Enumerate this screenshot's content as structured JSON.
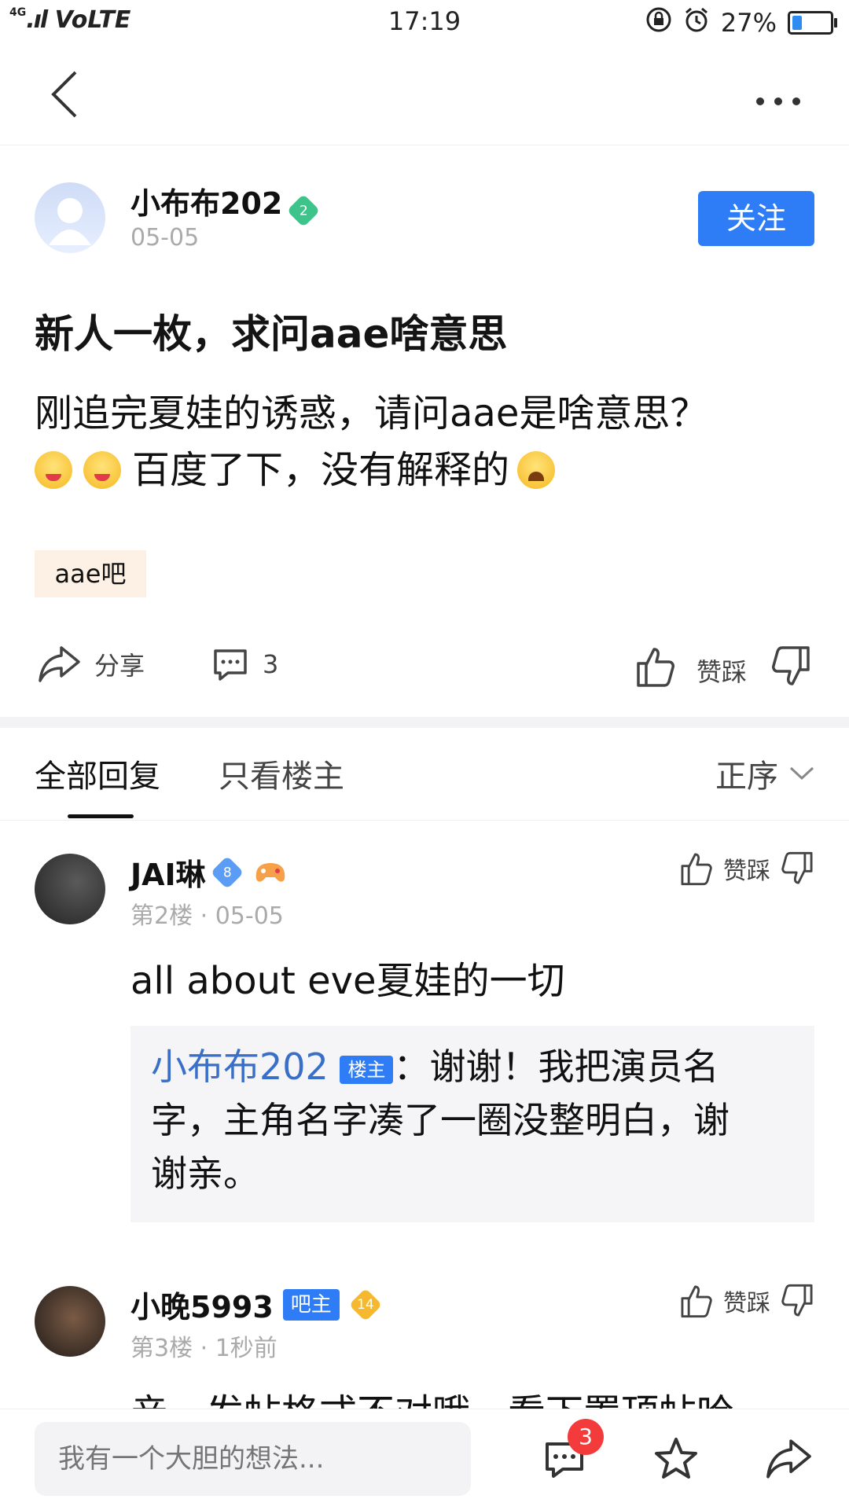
{
  "status_bar": {
    "signal": "4G",
    "network": "VoLTE",
    "time": "17:19",
    "battery": "27%",
    "battery_level": 0.27
  },
  "post": {
    "author": "小布布202",
    "author_level": "2",
    "date": "05-05",
    "follow_label": "关注",
    "title": "新人一枚，求问aae啥意思",
    "content_line1": "刚追完夏娃的诱惑，请问aae是啥意思？",
    "content_line2": "百度了下，没有解释的",
    "tag": "aae吧",
    "share_label": "分享",
    "comment_count": "3",
    "vote_label": "赞踩"
  },
  "tabs": {
    "all": "全部回复",
    "op_only": "只看楼主",
    "sort": "正序"
  },
  "replies": [
    {
      "name": "JAI琳",
      "level": "8",
      "floor": "第2楼",
      "date": "05-05",
      "text": "all about eve夏娃的一切",
      "vote_label": "赞踩",
      "quote": {
        "name": "小布布202",
        "badge": "楼主",
        "line1": "：谢谢！我把演员名",
        "line2": "字，主角名字凑了一圈没整明白，谢",
        "line3": "谢亲。"
      }
    },
    {
      "name": "小晚5993",
      "badge": "吧主",
      "level": "14",
      "floor": "第3楼",
      "date": "1秒前",
      "text": "亲，发帖格式不对哦，看下置顶帖哈",
      "vote_label": "赞踩"
    }
  ],
  "bottom_bar": {
    "input_placeholder": "我有一个大胆的想法...",
    "comment_badge": "3"
  }
}
